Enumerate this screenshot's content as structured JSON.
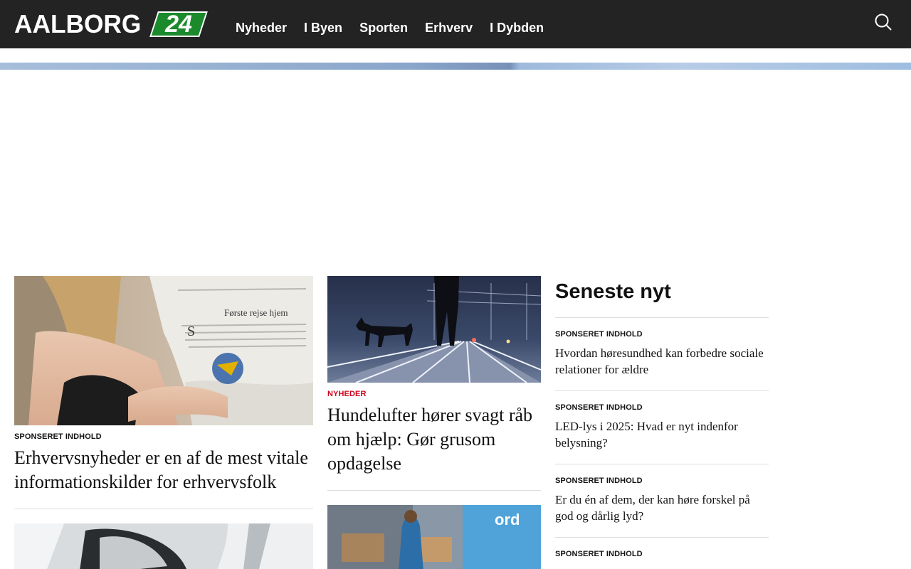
{
  "header": {
    "logo_text": "AALBORG",
    "logo_badge": "24",
    "nav": [
      {
        "label": "Nyheder"
      },
      {
        "label": "I Byen"
      },
      {
        "label": "Sporten"
      },
      {
        "label": "Erhverv"
      },
      {
        "label": "I Dybden"
      }
    ],
    "search_icon": "search-icon"
  },
  "articles_left": [
    {
      "category": "SPONSERET INDHOLD",
      "headline": "Erhvervsnyheder er en af de mest vitale informationskilder for erhvervsfolk",
      "image": "woman-reading-newspaper"
    },
    {
      "image": "car-side-mirror"
    }
  ],
  "articles_mid": [
    {
      "category": "NYHEDER",
      "headline": "Hundelufter hører svagt råb om hjælp: Gør grusom opdagelse",
      "image": "dog-on-railway-tracks"
    },
    {
      "image": "courier-loading-van"
    }
  ],
  "sidebar": {
    "title": "Seneste nyt",
    "items": [
      {
        "category": "SPONSERET INDHOLD",
        "headline": "Hvordan høresundhed kan forbedre sociale relationer for ældre"
      },
      {
        "category": "SPONSERET INDHOLD",
        "headline": "LED-lys i 2025: Hvad er nyt indenfor belysning?"
      },
      {
        "category": "SPONSERET INDHOLD",
        "headline": "Er du én af dem, der kan høre forskel på god og dårlig lyd?"
      },
      {
        "category": "SPONSERET INDHOLD",
        "headline": ""
      }
    ]
  },
  "colors": {
    "header_bg": "#232323",
    "badge_green": "#1b8a2c",
    "category_red": "#d0021b",
    "divider": "#dddddd"
  }
}
